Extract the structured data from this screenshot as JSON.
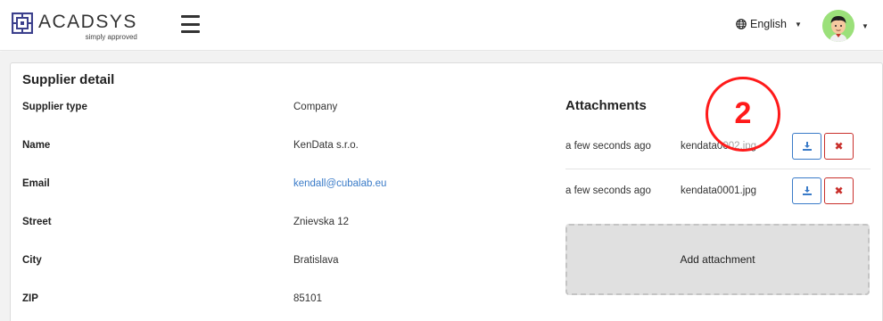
{
  "header": {
    "logo_name": "ACADSYS",
    "logo_tagline": "simply approved",
    "language": "English",
    "icons": {
      "logo": "acadsys-logo-icon",
      "menu": "hamburger-menu-icon",
      "language": "globe-icon",
      "avatar": "user-avatar"
    }
  },
  "supplier": {
    "title": "Supplier detail",
    "fields": [
      {
        "label": "Supplier type",
        "value": "Company"
      },
      {
        "label": "Name",
        "value": "KenData s.r.o."
      },
      {
        "label": "Email",
        "value": "kendall@cubalab.eu"
      },
      {
        "label": "Street",
        "value": "Znievska 12"
      },
      {
        "label": "City",
        "value": "Bratislava"
      },
      {
        "label": "ZIP",
        "value": "85101"
      }
    ]
  },
  "attachments": {
    "title": "Attachments",
    "items": [
      {
        "time": "a few seconds ago",
        "file": "kendata0002.jpg"
      },
      {
        "time": "a few seconds ago",
        "file": "kendata0001.jpg"
      }
    ],
    "add_label": "Add attachment"
  },
  "overlay": {
    "step_number": "2"
  },
  "colors": {
    "link": "#3a7bc8",
    "download_border": "#3a7bc8",
    "delete": "#c9302c",
    "step_marker": "#ff1a1a"
  }
}
